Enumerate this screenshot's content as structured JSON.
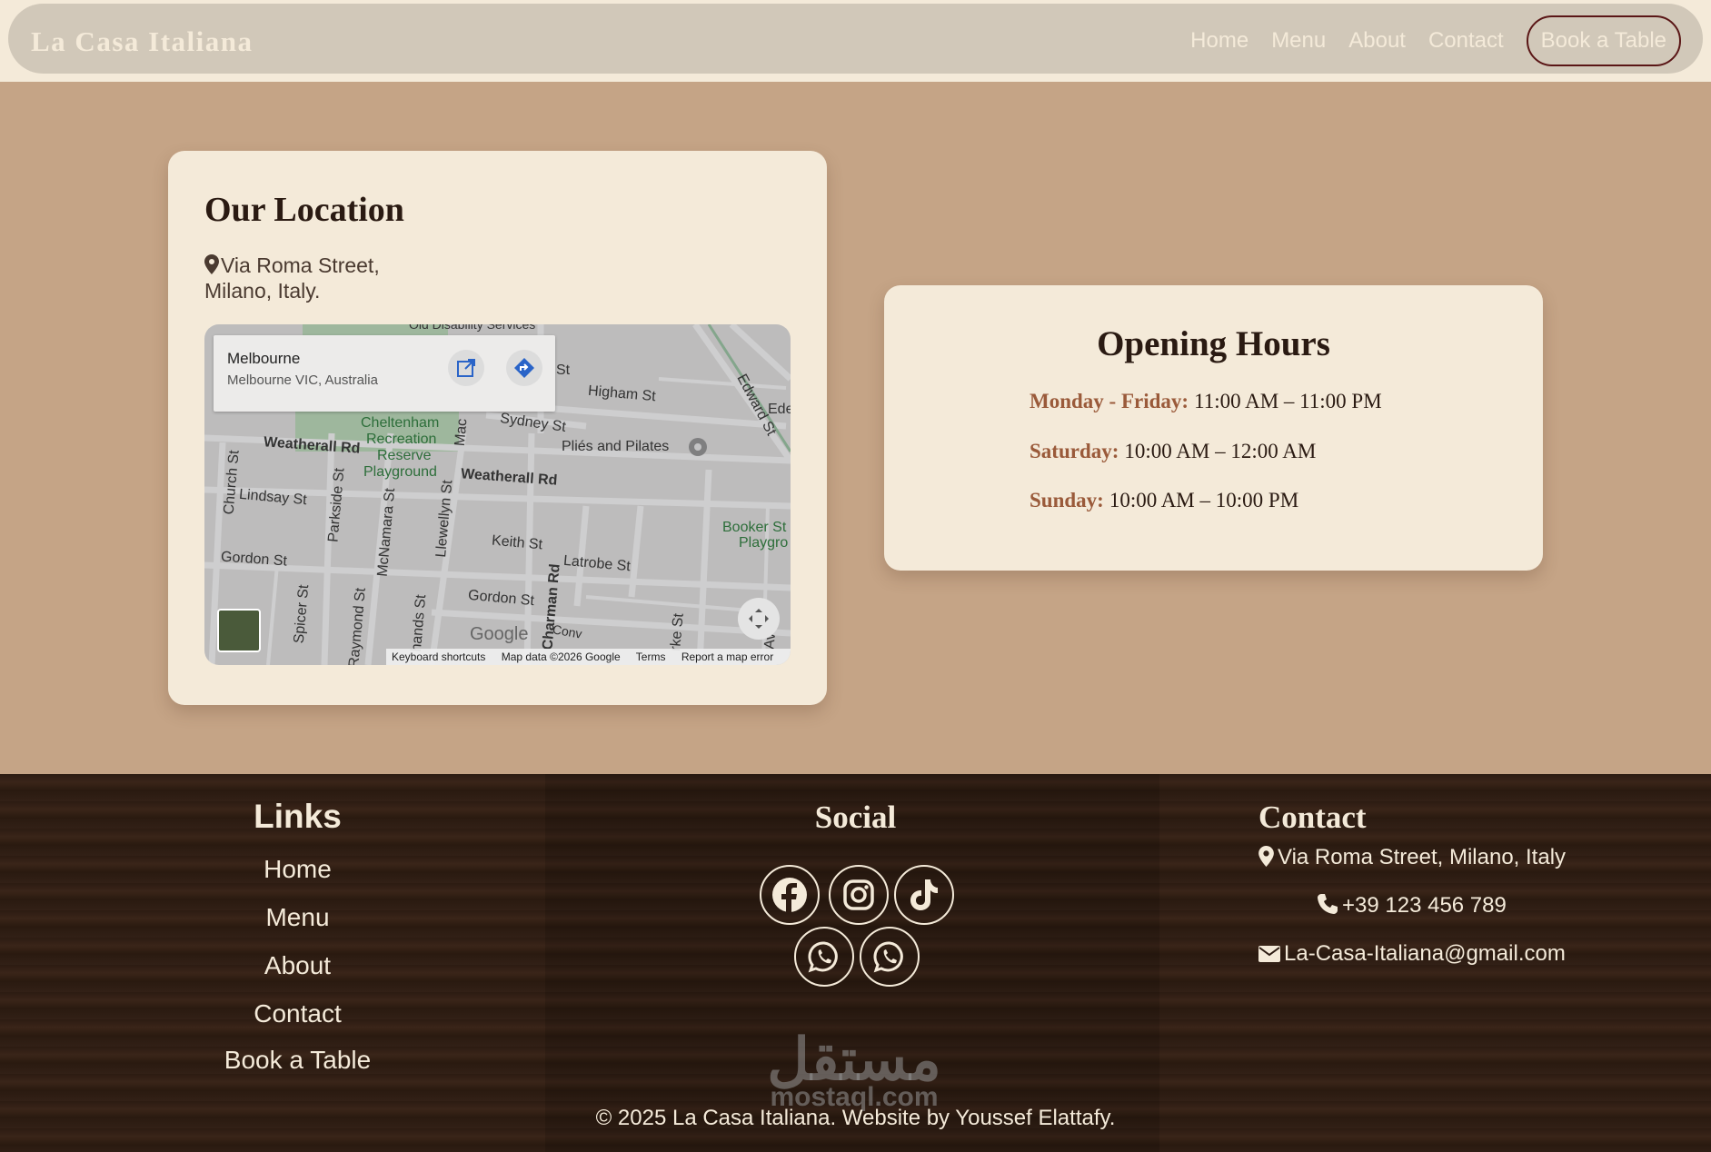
{
  "nav": {
    "brand": "La Casa Italiana",
    "links": [
      "Home",
      "Menu",
      "About",
      "Contact"
    ],
    "cta": "Book a Table"
  },
  "location": {
    "title": "Our Location",
    "address_line1": "Via Roma Street,",
    "address_line2": "Milano, Italy.",
    "map": {
      "place_title": "Melbourne",
      "place_subtitle": "Melbourne VIC, Australia",
      "labels": {
        "weatherall1": "Weatherall Rd",
        "weatherall2": "Weatherall Rd",
        "lindsay": "Lindsay St",
        "gordon1": "Gordon St",
        "gordon2": "Gordon St",
        "keith": "Keith St",
        "latrobe": "Latrobe St",
        "higham": "Higham St",
        "sydney": "Sydney St",
        "edward": "Edward St",
        "church": "Church St",
        "parkside": "Parkside St",
        "mcnamara": "McNamara St",
        "llewellyn": "Llewellyn St",
        "charman": "Charman Rd",
        "spicer": "Spicer St",
        "raymond": "Raymond St",
        "park1": "Cheltenham",
        "park2": "Recreation",
        "park3": "Reserve",
        "park4": "Playground",
        "plies": "Pliés and Pilates",
        "booker1": "Booker St",
        "booker2": "Playgro",
        "top": "Old Disability Services",
        "st": "St",
        "ede": "Ede",
        "mac": "Mac",
        "hands": "hands St",
        "conv": "Conv",
        "rke": "rke St",
        "ave": "Ave"
      },
      "google": "Google",
      "footer": [
        "Keyboard shortcuts",
        "Map data ©2026 Google",
        "Terms",
        "Report a map error"
      ]
    }
  },
  "hours": {
    "title": "Opening Hours",
    "rows": [
      {
        "day": "Monday - Friday:",
        "time": "11:00 AM – 11:00 PM"
      },
      {
        "day": "Saturday:",
        "time": "10:00 AM – 12:00 AM"
      },
      {
        "day": "Sunday:",
        "time": "10:00 AM – 10:00 PM"
      }
    ]
  },
  "footer": {
    "links_title": "Links",
    "links": [
      "Home",
      "Menu",
      "About",
      "Contact",
      "Book a Table"
    ],
    "social_title": "Social",
    "social": [
      "facebook-icon",
      "instagram-icon",
      "tiktok-icon",
      "whatsapp-icon",
      "whatsapp-icon"
    ],
    "contact_title": "Contact",
    "address": "Via Roma Street, Milano, Italy",
    "phone": "+39 123 456 789",
    "email": "La-Casa-Italiana@gmail.com",
    "watermark_ar": "مستقل",
    "watermark_en": "mostaql.com",
    "copyright": "© 2025 La Casa Italiana. Website by Youssef Elattafy."
  },
  "colors": {
    "page_bg": "#c5a486",
    "card_bg": "#f4ead9",
    "nav_bg": "#d1c8b9",
    "accent_day": "#9a5a3a",
    "cta_border": "#5a1616",
    "footer_bg": "#2c1b12"
  }
}
